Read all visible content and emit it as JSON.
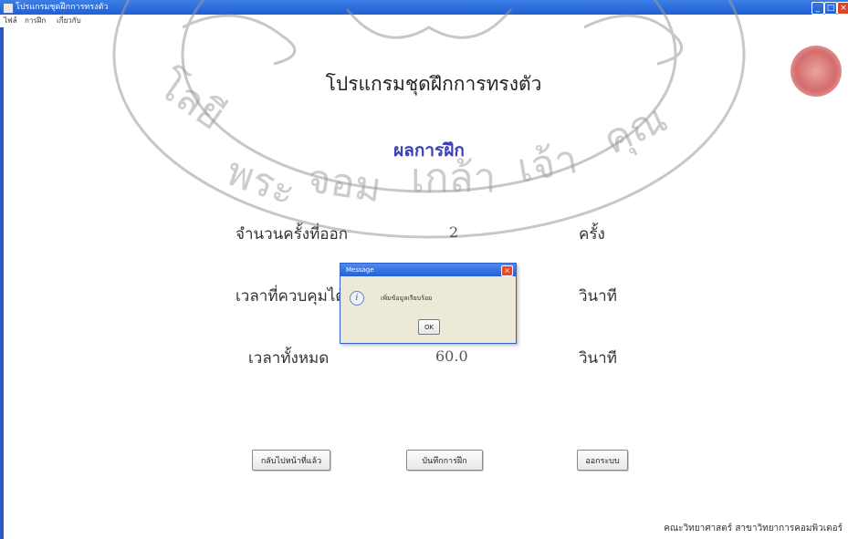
{
  "window": {
    "title": "โปรแกรมชุดฝึกการทรงตัว",
    "min_glyph": "_",
    "max_glyph": "□",
    "close_glyph": "×"
  },
  "menu": {
    "items": [
      {
        "label": "ไฟล์"
      },
      {
        "label": "การฝึก"
      },
      {
        "label": "เกี่ยวกับ"
      }
    ]
  },
  "main": {
    "program_title": "โปรแกรมชุดฝึกการทรงตัว",
    "result_title": "ผลการฝึก",
    "rows": [
      {
        "label": "จำนวนครั้งที่ออก",
        "value": "2",
        "unit": "ครั้ง"
      },
      {
        "label": "เวลาที่ควบคุมได้",
        "value": "",
        "unit": "วินาที"
      },
      {
        "label": "เวลาทั้งหมด",
        "value": "60.0",
        "unit": "วินาที"
      }
    ],
    "buttons": {
      "back": "กลับไปหน้าที่แล้ว",
      "save": "บันทึกการฝึก",
      "exit": "ออกระบบ"
    }
  },
  "dialog": {
    "title": "Message",
    "message": "เพิ่มข้อมูลเรียบร้อย",
    "ok": "OK",
    "icon": "info-icon",
    "close_glyph": "×"
  },
  "footer": {
    "text": "คณะวิทยาศาสตร์ สาขาวิทยาการคอมพิวเตอร์"
  },
  "colors": {
    "titlebar": "#1f5fd3",
    "result_title": "#3d3fb3",
    "dialog_bg": "#ece9d8",
    "watermark": "#8c8c8c"
  }
}
